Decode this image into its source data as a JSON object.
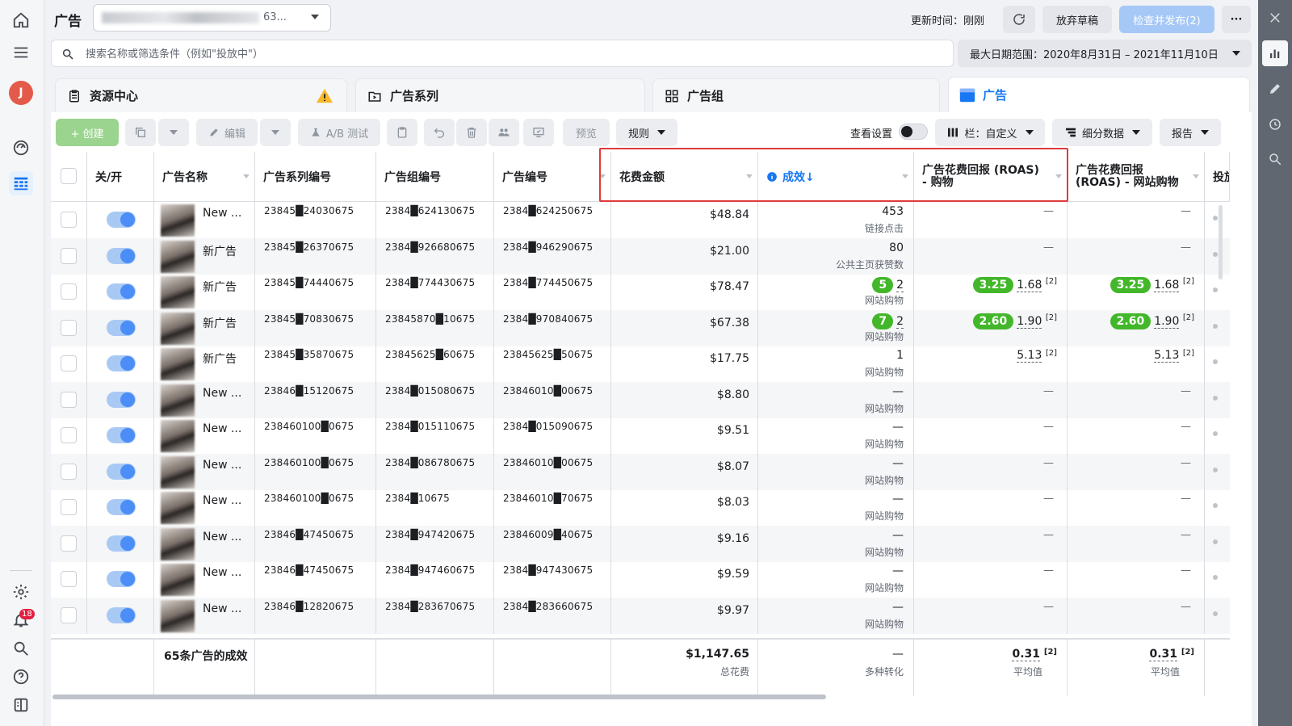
{
  "app": {
    "title": "广告"
  },
  "account": {
    "selector_text": "广告 ██████ (█ ████████63..."
  },
  "header": {
    "update_time_label": "更新时间：刚刚",
    "discard_label": "放弃草稿",
    "publish_label": "检查并发布(2)",
    "more_label": "···"
  },
  "search": {
    "placeholder": "搜索名称或筛选条件（例如\"投放中\"）"
  },
  "date_range": {
    "label": "最大日期范围：2020年8月31日 – 2021年11月10日"
  },
  "tabs": [
    {
      "label": "资源中心",
      "icon": "clipboard-icon"
    },
    {
      "label": "广告系列",
      "icon": "folder-icon"
    },
    {
      "label": "广告组",
      "icon": "grid-icon"
    },
    {
      "label": "广告",
      "icon": "ad-icon"
    }
  ],
  "toolbar": {
    "create_label": "+ 创建",
    "edit_label": "编辑",
    "ab_test_label": "A/B 测试",
    "preview_label": "预览",
    "rules_label": "规则",
    "view_settings_label": "查看设置",
    "columns_label": "栏：自定义",
    "breakdown_label": "细分数据",
    "reports_label": "报告"
  },
  "table": {
    "columns": [
      "关/开",
      "广告名称",
      "广告系列编号",
      "广告组编号",
      "广告编号",
      "花费金额",
      "成效↓",
      "广告花费回报 (ROAS)\n- 购物",
      "广告花费回报\n(ROAS) - 网站购物",
      "投放"
    ],
    "rows": [
      {
        "name": "New ...",
        "campaign_id": "23845█24030675",
        "adset_id": "2384█624130675",
        "ad_id": "2384█624250675",
        "spend": "$48.84",
        "result": "453",
        "result_label": "链接点击",
        "roas_p": "—",
        "roas_w": "—"
      },
      {
        "name": "新广告",
        "campaign_id": "23845█26370675",
        "adset_id": "2384█926680675",
        "ad_id": "2384█946290675",
        "spend": "$21.00",
        "result": "80",
        "result_label": "公共主页获赞数",
        "roas_p": "—",
        "roas_w": "—"
      },
      {
        "name": "新广告",
        "campaign_id": "23845█74440675",
        "adset_id": "2384█774430675",
        "ad_id": "2384█774450675",
        "spend": "$78.47",
        "result_pill": "5",
        "result": "2",
        "result_label": "网站购物",
        "roas_pill": "3.25",
        "roas_p": "1.68",
        "roas_w_pill": "3.25",
        "roas_w": "1.68"
      },
      {
        "name": "新广告",
        "campaign_id": "23845█70830675",
        "adset_id": "23845870█10675",
        "ad_id": "2384█970840675",
        "spend": "$67.38",
        "result_pill": "7",
        "result": "2",
        "result_label": "网站购物",
        "roas_pill": "2.60",
        "roas_p": "1.90",
        "roas_w_pill": "2.60",
        "roas_w": "1.90"
      },
      {
        "name": "新广告",
        "campaign_id": "23845█35870675",
        "adset_id": "23845625█60675",
        "ad_id": "23845625█50675",
        "spend": "$17.75",
        "result": "1",
        "result_label": "网站购物",
        "roas_p": "5.13",
        "roas_w": "5.13"
      },
      {
        "name": "New ...",
        "campaign_id": "23846█15120675",
        "adset_id": "2384█015080675",
        "ad_id": "23846010█00675",
        "spend": "$8.80",
        "result": "—",
        "result_label": "网站购物",
        "roas_p": "—",
        "roas_w": "—"
      },
      {
        "name": "New ...",
        "campaign_id": "238460100█0675",
        "adset_id": "2384█015110675",
        "ad_id": "2384█015090675",
        "spend": "$9.51",
        "result": "—",
        "result_label": "网站购物",
        "roas_p": "—",
        "roas_w": "—"
      },
      {
        "name": "New ...",
        "campaign_id": "238460100█0675",
        "adset_id": "2384█086780675",
        "ad_id": "23846010█00675",
        "spend": "$8.07",
        "result": "—",
        "result_label": "网站购物",
        "roas_p": "—",
        "roas_w": "—"
      },
      {
        "name": "New ...",
        "campaign_id": "238460100█0675",
        "adset_id": "2384█10675",
        "ad_id": "23846010█70675",
        "spend": "$8.03",
        "result": "—",
        "result_label": "网站购物",
        "roas_p": "—",
        "roas_w": "—"
      },
      {
        "name": "New ...",
        "campaign_id": "23846█47450675",
        "adset_id": "2384█947420675",
        "ad_id": "23846009█40675",
        "spend": "$9.16",
        "result": "—",
        "result_label": "网站购物",
        "roas_p": "—",
        "roas_w": "—"
      },
      {
        "name": "New ...",
        "campaign_id": "23846█47450675",
        "adset_id": "2384█947460675",
        "ad_id": "2384█947430675",
        "spend": "$9.59",
        "result": "—",
        "result_label": "网站购物",
        "roas_p": "—",
        "roas_w": "—"
      },
      {
        "name": "New ...",
        "campaign_id": "23846█12820675",
        "adset_id": "2384█283670675",
        "ad_id": "2384█283660675",
        "spend": "$9.97",
        "result": "—",
        "result_label": "网站购物",
        "roas_p": "—",
        "roas_w": "—"
      }
    ],
    "footer": {
      "label": "65条广告的成效",
      "spend_total": "$1,147.65",
      "spend_caption": "总花费",
      "result_total": "—",
      "result_caption": "多种转化",
      "roas_p": "0.31",
      "roas_w": "0.31",
      "avg_caption": "平均值",
      "sup": "[2]"
    },
    "sup": "[2]"
  },
  "nav": {
    "notification_count": "18",
    "avatar_letter": "J"
  },
  "colors": {
    "primary": "#1877f2",
    "highlight_border": "#e03a3a",
    "pill_green": "#42b72a",
    "create_green": "#9bd48e"
  }
}
